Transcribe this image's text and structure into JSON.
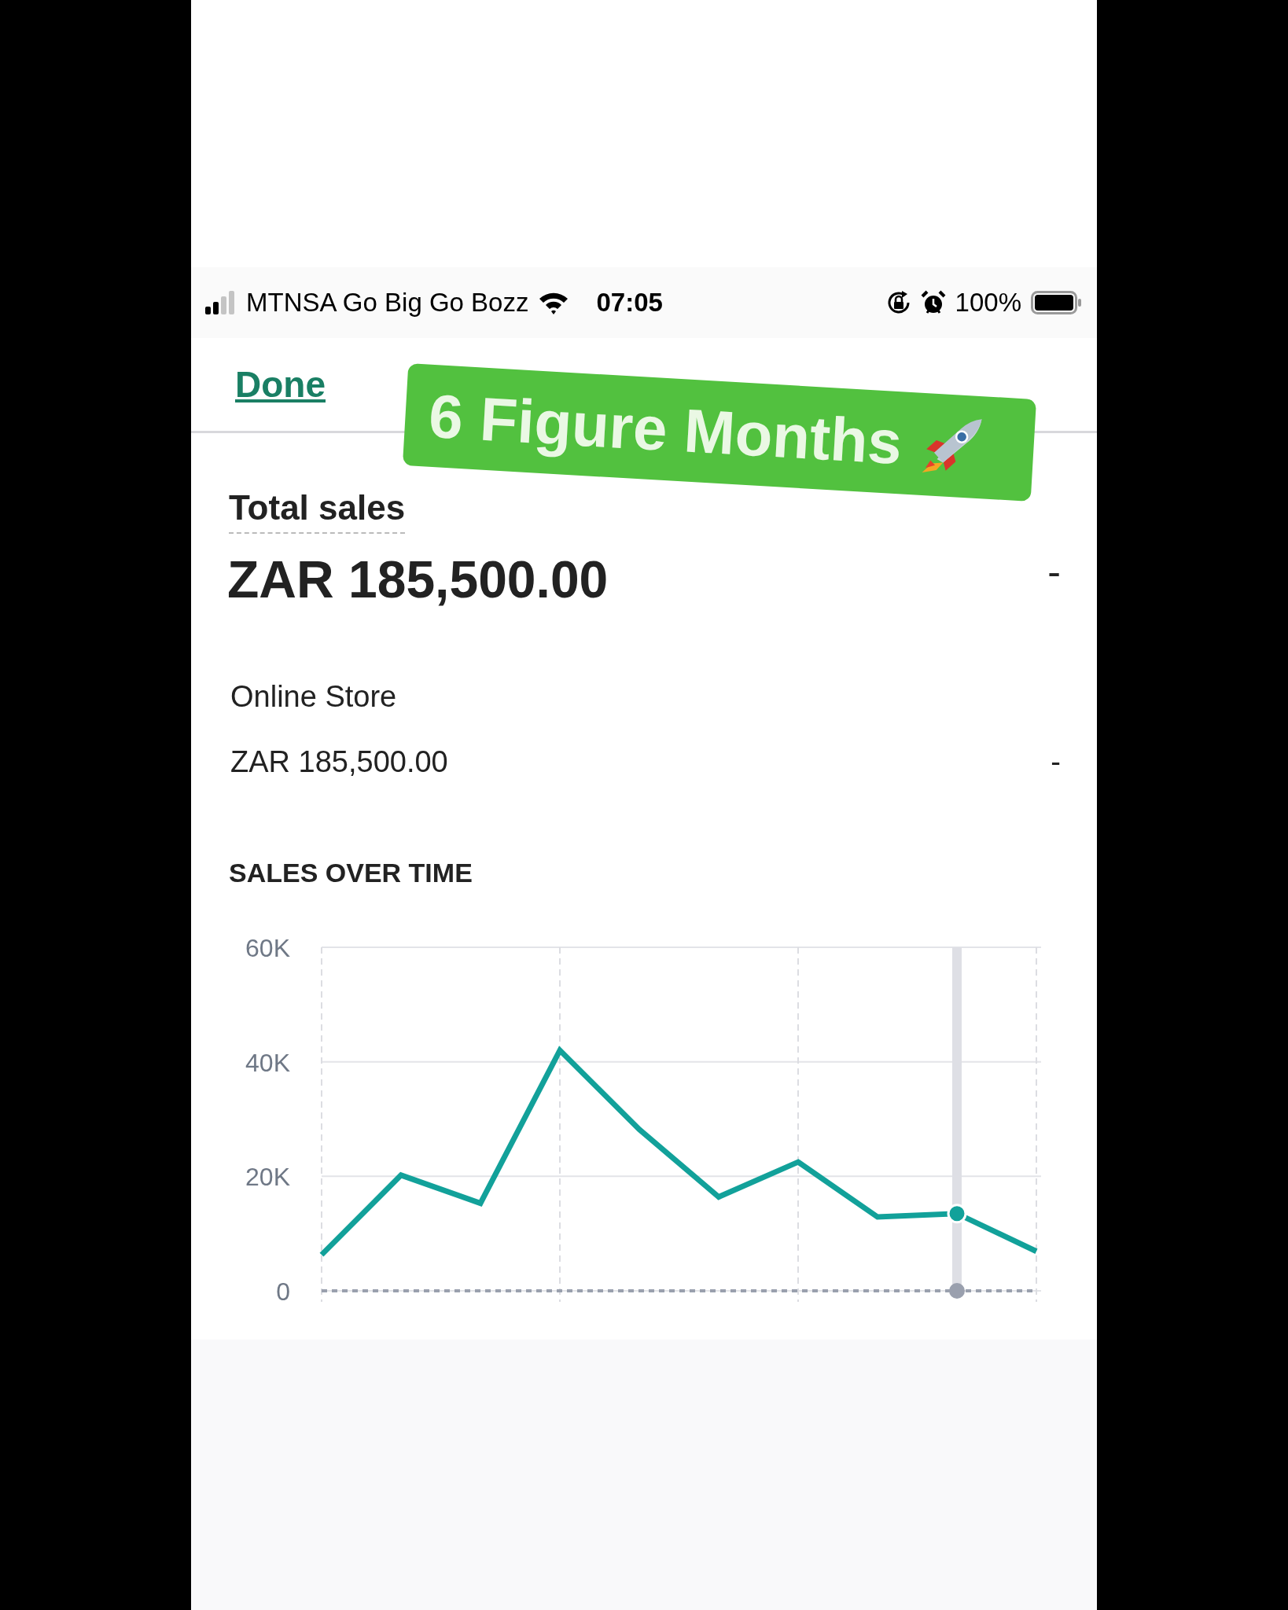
{
  "status_bar": {
    "carrier": "MTNSA Go Big Go Bozz",
    "time": "07:05",
    "battery": "100%"
  },
  "nav": {
    "done": "Done"
  },
  "sticker": {
    "text": "6 Figure Months"
  },
  "total_sales": {
    "label": "Total sales",
    "value": "ZAR 185,500.00",
    "change": "-"
  },
  "channels": [
    {
      "name": "Online Store",
      "value": "ZAR 185,500.00",
      "change": "-"
    }
  ],
  "sales_over_time": {
    "title": "SALES OVER TIME",
    "chart_data": {
      "type": "line",
      "grid": true,
      "ylim": [
        0,
        60000
      ],
      "yticks": [
        {
          "value": 0,
          "label": "0"
        },
        {
          "value": 20000,
          "label": "20K"
        },
        {
          "value": 40000,
          "label": "40K"
        },
        {
          "value": 60000,
          "label": "60K"
        }
      ],
      "series": [
        {
          "color": "#12a19a",
          "values": [
            6300,
            20200,
            15300,
            42000,
            28200,
            16400,
            22500,
            12900,
            13500,
            6900
          ]
        }
      ]
    }
  }
}
